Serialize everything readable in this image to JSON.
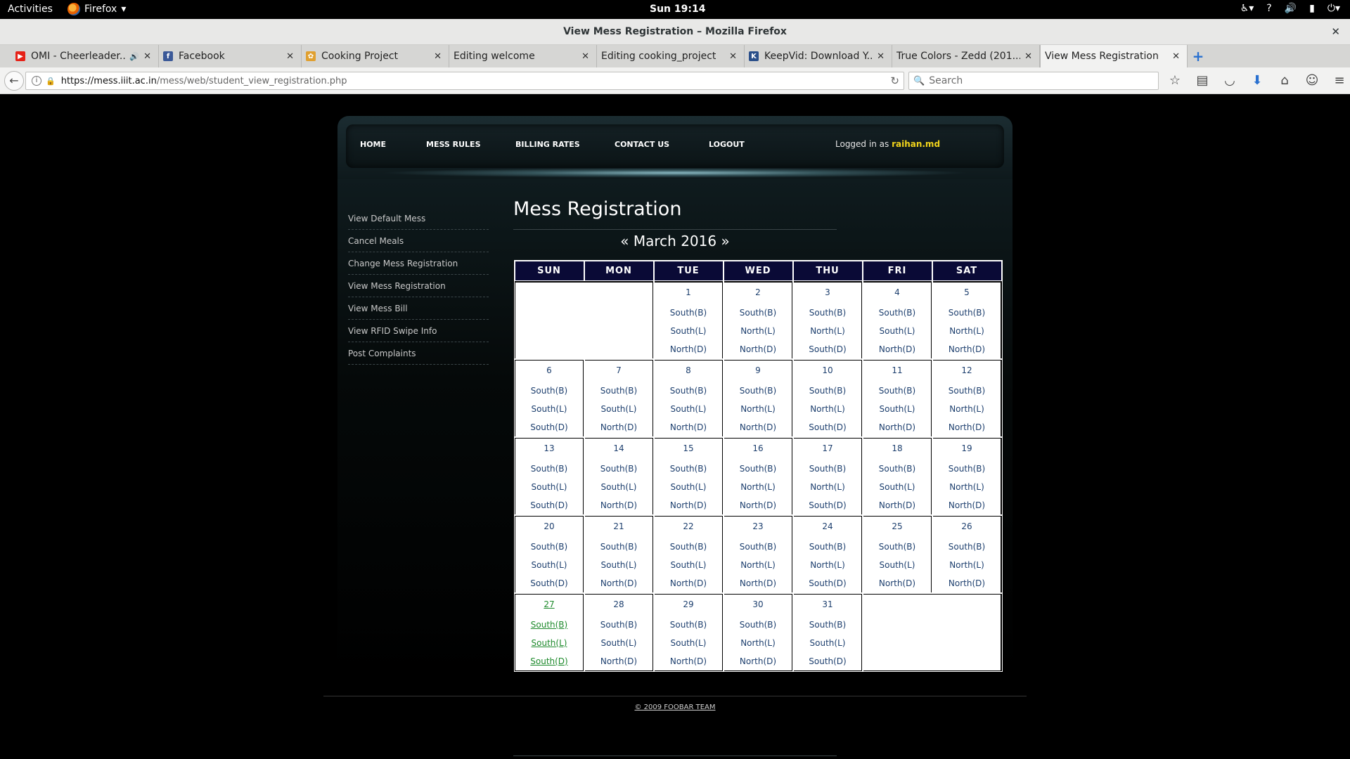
{
  "topbar": {
    "activities": "Activities",
    "app": "Firefox",
    "clock": "Sun 19:14"
  },
  "window": {
    "title": "View Mess Registration – Mozilla Firefox"
  },
  "tabs": [
    {
      "label": "OMI - Cheerleader...",
      "icon": "youtube-icon",
      "color": "#e62117"
    },
    {
      "label": "Facebook",
      "icon": "facebook-icon",
      "color": "#3b5998"
    },
    {
      "label": "Cooking Project",
      "icon": "cooking-icon",
      "color": "#e0a030"
    },
    {
      "label": "Editing welcome",
      "icon": "",
      "color": ""
    },
    {
      "label": "Editing cooking_project",
      "icon": "",
      "color": ""
    },
    {
      "label": "KeepVid: Download Y...",
      "icon": "keepvid-icon",
      "color": "#2a4f8a"
    },
    {
      "label": "True Colors - Zedd (201...",
      "icon": "",
      "color": ""
    },
    {
      "label": "View Mess Registration",
      "icon": "",
      "color": ""
    }
  ],
  "nav": {
    "url_host": "https://mess.iiit.ac.in",
    "url_path": "/mess/web/student_view_registration.php",
    "search_placeholder": "Search"
  },
  "site": {
    "menu": {
      "home": "HOME",
      "mess_rules": "MESS RULES",
      "billing_rates": "BILLING RATES",
      "contact_us": "CONTACT US",
      "logout": "LOGOUT",
      "logged_in_prefix": "Logged in as",
      "username": "raihan.md"
    },
    "sidebar": [
      "View Default Mess",
      "Cancel Meals",
      "Change Mess Registration",
      "View Mess Registration",
      "View Mess Bill",
      "View RFID Swipe Info",
      "Post Complaints"
    ],
    "page_title": "Mess Registration",
    "month_label": "« March 2016 »",
    "weekdays": [
      "SUN",
      "MON",
      "TUE",
      "WED",
      "THU",
      "FRI",
      "SAT"
    ],
    "weeks": [
      [
        null,
        null,
        {
          "day": "1",
          "meals": [
            "South(B)",
            "South(L)",
            "North(D)"
          ]
        },
        {
          "day": "2",
          "meals": [
            "South(B)",
            "North(L)",
            "North(D)"
          ]
        },
        {
          "day": "3",
          "meals": [
            "South(B)",
            "North(L)",
            "South(D)"
          ]
        },
        {
          "day": "4",
          "meals": [
            "South(B)",
            "South(L)",
            "North(D)"
          ]
        },
        {
          "day": "5",
          "meals": [
            "South(B)",
            "North(L)",
            "North(D)"
          ]
        }
      ],
      [
        {
          "day": "6",
          "meals": [
            "South(B)",
            "South(L)",
            "South(D)"
          ]
        },
        {
          "day": "7",
          "meals": [
            "South(B)",
            "South(L)",
            "North(D)"
          ]
        },
        {
          "day": "8",
          "meals": [
            "South(B)",
            "South(L)",
            "North(D)"
          ]
        },
        {
          "day": "9",
          "meals": [
            "South(B)",
            "North(L)",
            "North(D)"
          ]
        },
        {
          "day": "10",
          "meals": [
            "South(B)",
            "North(L)",
            "South(D)"
          ]
        },
        {
          "day": "11",
          "meals": [
            "South(B)",
            "South(L)",
            "North(D)"
          ]
        },
        {
          "day": "12",
          "meals": [
            "South(B)",
            "North(L)",
            "North(D)"
          ]
        }
      ],
      [
        {
          "day": "13",
          "meals": [
            "South(B)",
            "South(L)",
            "South(D)"
          ]
        },
        {
          "day": "14",
          "meals": [
            "South(B)",
            "South(L)",
            "North(D)"
          ]
        },
        {
          "day": "15",
          "meals": [
            "South(B)",
            "South(L)",
            "North(D)"
          ]
        },
        {
          "day": "16",
          "meals": [
            "South(B)",
            "North(L)",
            "North(D)"
          ]
        },
        {
          "day": "17",
          "meals": [
            "South(B)",
            "North(L)",
            "South(D)"
          ]
        },
        {
          "day": "18",
          "meals": [
            "South(B)",
            "South(L)",
            "North(D)"
          ]
        },
        {
          "day": "19",
          "meals": [
            "South(B)",
            "North(L)",
            "North(D)"
          ]
        }
      ],
      [
        {
          "day": "20",
          "meals": [
            "South(B)",
            "South(L)",
            "South(D)"
          ]
        },
        {
          "day": "21",
          "meals": [
            "South(B)",
            "South(L)",
            "North(D)"
          ]
        },
        {
          "day": "22",
          "meals": [
            "South(B)",
            "South(L)",
            "North(D)"
          ]
        },
        {
          "day": "23",
          "meals": [
            "South(B)",
            "North(L)",
            "North(D)"
          ]
        },
        {
          "day": "24",
          "meals": [
            "South(B)",
            "North(L)",
            "South(D)"
          ]
        },
        {
          "day": "25",
          "meals": [
            "South(B)",
            "South(L)",
            "North(D)"
          ]
        },
        {
          "day": "26",
          "meals": [
            "South(B)",
            "North(L)",
            "North(D)"
          ]
        }
      ],
      [
        {
          "day": "27",
          "meals": [
            "South(B)",
            "South(L)",
            "South(D)"
          ],
          "today": true
        },
        {
          "day": "28",
          "meals": [
            "South(B)",
            "South(L)",
            "North(D)"
          ]
        },
        {
          "day": "29",
          "meals": [
            "South(B)",
            "South(L)",
            "North(D)"
          ]
        },
        {
          "day": "30",
          "meals": [
            "South(B)",
            "North(L)",
            "North(D)"
          ]
        },
        {
          "day": "31",
          "meals": [
            "South(B)",
            "South(L)",
            "South(D)"
          ]
        },
        null,
        null
      ]
    ],
    "footer": "© 2009 FOOBAR TEAM"
  },
  "colors": {
    "calendar_header_bg": "#0a0a36",
    "meal_link": "#1d3f6e",
    "today_link": "#1e8a2c",
    "username": "#f2d41b"
  }
}
